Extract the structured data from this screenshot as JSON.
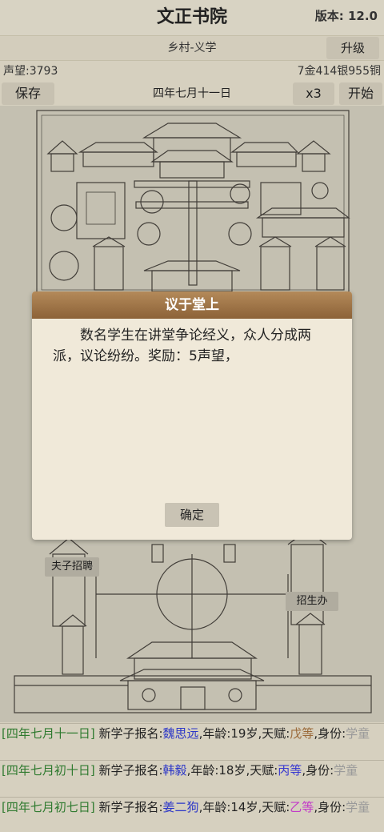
{
  "header": {
    "title": "文正书院",
    "version": "版本: 12.0"
  },
  "location": {
    "text": "乡村-义学",
    "upgrade_label": "升级"
  },
  "stats": {
    "reputation": "声望:3793",
    "money": "7金414银955铜"
  },
  "toolbar": {
    "save_label": "保存",
    "date": "四年七月十一日",
    "speed_label": "x3",
    "start_label": "开始"
  },
  "map": {
    "hire_label": "夫子招聘",
    "recruit_label": "招生办"
  },
  "dialog": {
    "title": "议于堂上",
    "body": "数名学生在讲堂争论经义，众人分成两派，议论纷纷。奖励：5声望，",
    "ok_label": "确定"
  },
  "log": [
    {
      "date": "[四年七月十一日]",
      "prefix": " 新学子报名:",
      "name": "魏思远",
      "age": ",年龄:19岁,天赋:",
      "talent": "戊等",
      "role_prefix": ",身份:",
      "role": "学童"
    },
    {
      "date": "[四年七月初十日]",
      "prefix": " 新学子报名:",
      "name": "韩毅",
      "age": ",年龄:18岁,天赋:",
      "talent": "丙等",
      "role_prefix": ",身份:",
      "role": "学童"
    },
    {
      "date": "[四年七月初七日]",
      "prefix": " 新学子报名:",
      "name": "姜二狗",
      "age": ",年龄:14岁,天赋:",
      "talent": "乙等",
      "role_prefix": ",身份:",
      "role": "学童"
    }
  ],
  "colors": {
    "log_date": "#2f7a2f",
    "log_name": "#2a35c8",
    "dialog_header": "#8c6238",
    "background": "#d6d0bf"
  }
}
